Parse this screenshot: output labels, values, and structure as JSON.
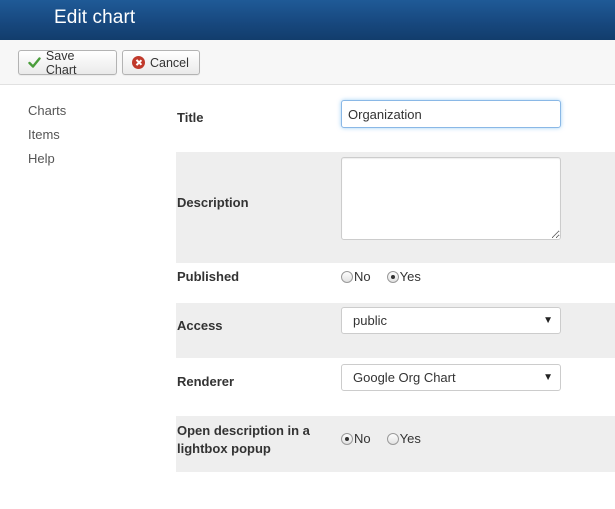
{
  "window": {
    "title": "Edit chart"
  },
  "toolbar": {
    "save_label": "Save Chart",
    "cancel_label": "Cancel"
  },
  "sidebar": {
    "items": [
      {
        "label": "Charts"
      },
      {
        "label": "Items"
      },
      {
        "label": "Help"
      }
    ]
  },
  "form": {
    "title": {
      "label": "Title",
      "value": "Organization"
    },
    "description": {
      "label": "Description",
      "value": ""
    },
    "published": {
      "label": "Published",
      "options": [
        "No",
        "Yes"
      ],
      "selected": "Yes"
    },
    "access": {
      "label": "Access",
      "value": "public"
    },
    "renderer": {
      "label": "Renderer",
      "value": "Google Org Chart"
    },
    "lightbox": {
      "label": "Open description in a lightbox popup",
      "options": [
        "No",
        "Yes"
      ],
      "selected": "No"
    }
  },
  "colors": {
    "header": "#17477d",
    "shaded_row": "#eeeeee",
    "focus_border": "#8ab8e6",
    "cancel_icon": "#c0392b",
    "check_icon": "#4a9d3b"
  }
}
